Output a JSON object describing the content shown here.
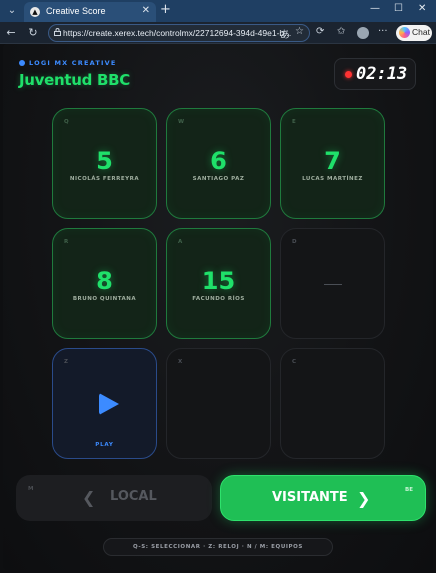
{
  "browser": {
    "tab_title": "Creative Score",
    "url": "https://create.xerex.tech/controlmx/22712694-394d-49e1-b...",
    "chat_label": "Chat"
  },
  "app": {
    "brand": "LOGI MX CREATIVE",
    "team_name": "Juventud BBC",
    "clock": "02:13",
    "pads": [
      {
        "key": "Q",
        "number": "5",
        "name": "NICOLÁS FERREYRA"
      },
      {
        "key": "W",
        "number": "6",
        "name": "SANTIAGO PAZ"
      },
      {
        "key": "E",
        "number": "7",
        "name": "LUCAS MARTÍNEZ"
      },
      {
        "key": "R",
        "number": "8",
        "name": "BRUNO QUINTANA"
      },
      {
        "key": "A",
        "number": "15",
        "name": "FACUNDO RÍOS"
      },
      {
        "key": "D",
        "number": "",
        "name": ""
      },
      {
        "key": "Z",
        "label": "PLAY"
      },
      {
        "key": "X"
      },
      {
        "key": "C"
      }
    ],
    "local_key": "M",
    "local_label": "LOCAL",
    "visit_key": "BE",
    "visit_label": "VISITANTE",
    "hints": "Q-S: SELECCIONAR  ·  Z: RELOJ  ·  N / M: EQUIPOS"
  },
  "colors": {
    "accent_green": "#1fe06a",
    "accent_blue": "#3c8bff",
    "record_red": "#ff3232"
  }
}
